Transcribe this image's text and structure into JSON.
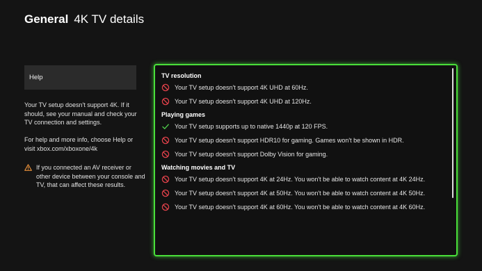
{
  "header": {
    "section": "General",
    "title": "4K TV details"
  },
  "sidebar": {
    "help_label": "Help",
    "paragraph1": "Your TV setup doesn't support 4K. If it should, see your manual and check your TV connection and settings.",
    "paragraph2": "For help and more info, choose Help or visit xbox.com/xboxone/4k",
    "warning": "If you connected an AV receiver or other device between your console and TV, that can affect these results."
  },
  "details": {
    "groups": [
      {
        "heading": "TV resolution",
        "items": [
          {
            "status": "no",
            "text": "Your TV setup doesn't support 4K UHD at 60Hz."
          },
          {
            "status": "no",
            "text": "Your TV setup doesn't support 4K UHD at 120Hz."
          }
        ]
      },
      {
        "heading": "Playing games",
        "items": [
          {
            "status": "yes",
            "text": "Your TV setup supports up to native 1440p at 120 FPS."
          },
          {
            "status": "no",
            "text": "Your TV setup doesn't support HDR10 for gaming. Games won't be shown in HDR."
          },
          {
            "status": "no",
            "text": "Your TV setup doesn't support Dolby Vision for gaming."
          }
        ]
      },
      {
        "heading": "Watching movies and TV",
        "items": [
          {
            "status": "no",
            "text": "Your TV setup doesn't support 4K at 24Hz. You won't be able to watch content at 4K 24Hz."
          },
          {
            "status": "no",
            "text": "Your TV setup doesn't support 4K at 50Hz. You won't be able to watch content at 4K 50Hz."
          },
          {
            "status": "no",
            "text": "Your TV setup doesn't support 4K at 60Hz. You won't be able to watch content at 4K 60Hz."
          }
        ]
      }
    ]
  },
  "colors": {
    "focus_border": "#49e03a",
    "no_icon": "#e0414a",
    "yes_icon": "#4ec94a",
    "warning_icon": "#e8903a"
  },
  "icons": {
    "no": "prohibited-icon",
    "yes": "checkmark-icon",
    "warning": "warning-triangle-icon"
  }
}
